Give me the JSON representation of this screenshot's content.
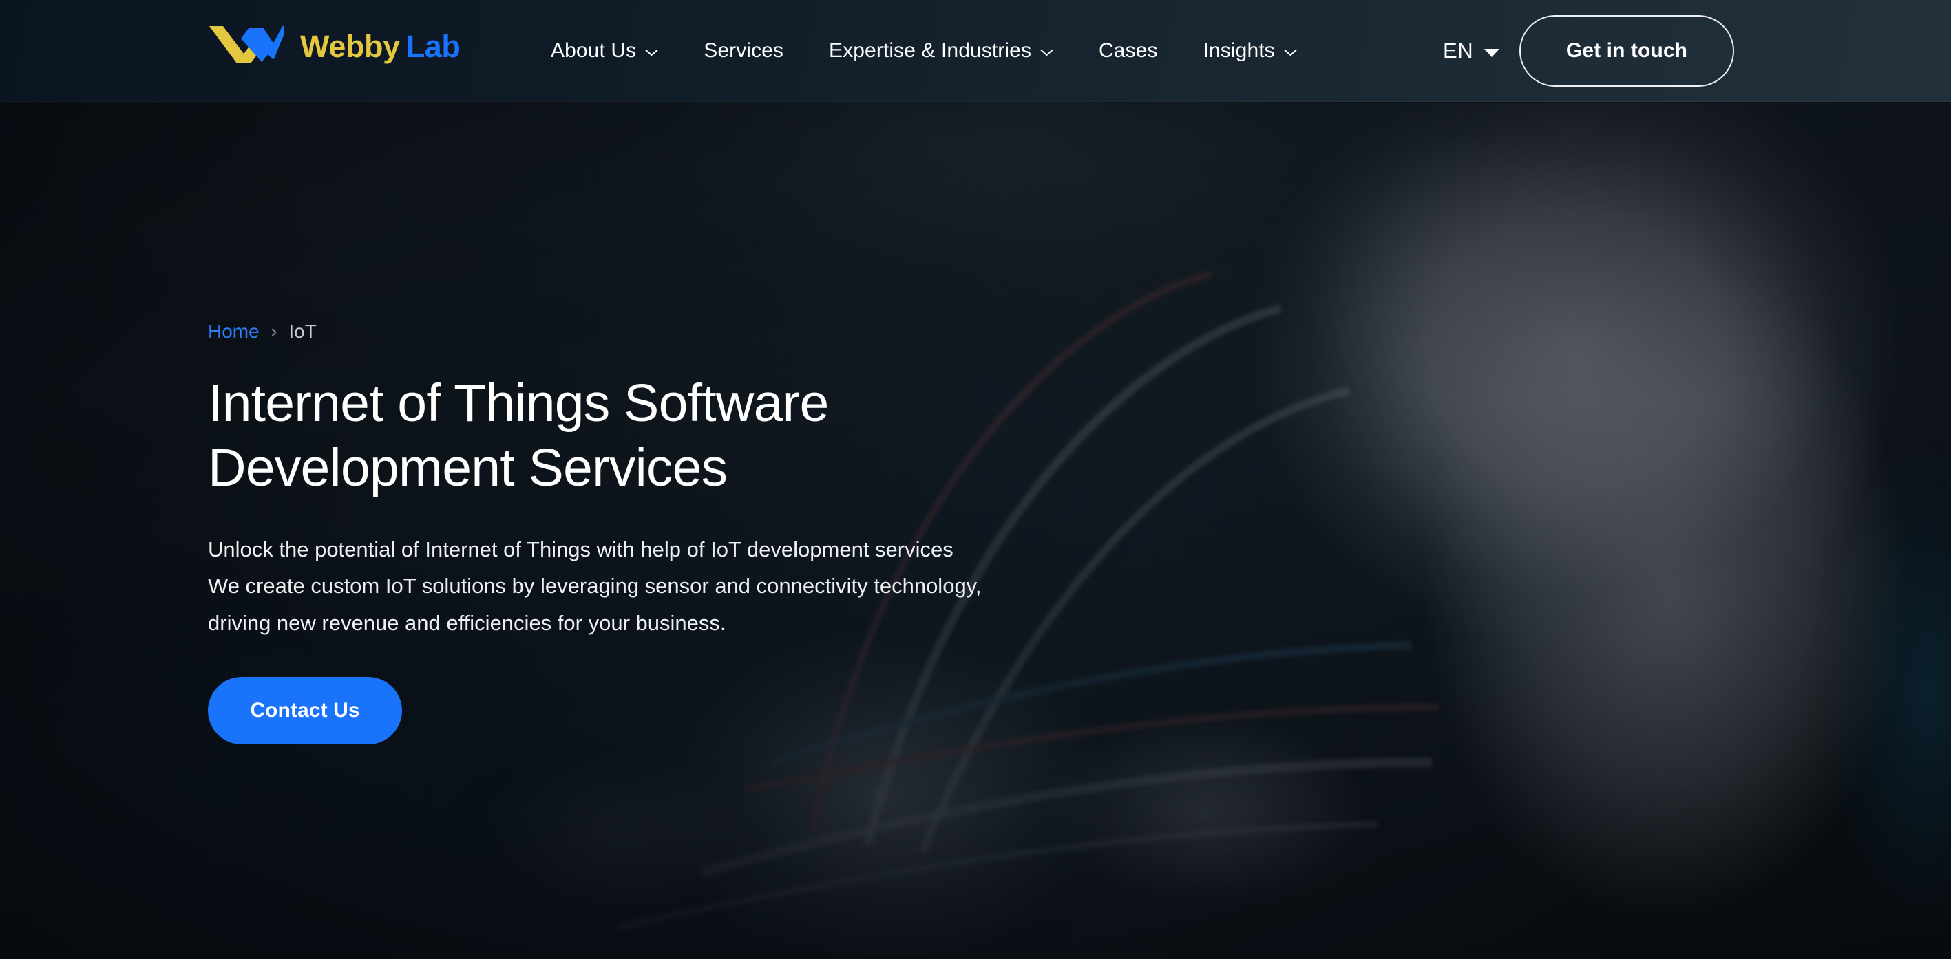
{
  "brand": {
    "name_part1": "Webby",
    "name_part2": "Lab",
    "logo_icon": "webbylab-w-mark-icon",
    "color_yellow": "#e3c73f",
    "color_blue": "#1a74fb"
  },
  "header": {
    "nav": [
      {
        "label": "About Us",
        "has_dropdown": true,
        "icon": "chevron-down-icon"
      },
      {
        "label": "Services",
        "has_dropdown": false,
        "icon": ""
      },
      {
        "label": "Expertise & Industries",
        "has_dropdown": true,
        "icon": "chevron-down-icon"
      },
      {
        "label": "Cases",
        "has_dropdown": false,
        "icon": ""
      },
      {
        "label": "Insights",
        "has_dropdown": true,
        "icon": "chevron-down-icon"
      }
    ],
    "language": {
      "selected": "EN",
      "icon": "caret-down-icon"
    },
    "cta_label": "Get in touch"
  },
  "hero": {
    "breadcrumb": {
      "home_label": "Home",
      "separator": "›",
      "current_label": "IoT"
    },
    "title": "Internet of Things Software Development Services",
    "subtitle_lines": [
      "Unlock the potential of Internet of Things with help of IoT development services",
      "We create custom IoT solutions by leveraging sensor and connectivity technology,",
      "driving new revenue and efficiencies for your business."
    ],
    "cta_label": "Contact Us",
    "cta_color": "#1a74fb",
    "background_image": "blurred-electronics-workbench-photo"
  }
}
